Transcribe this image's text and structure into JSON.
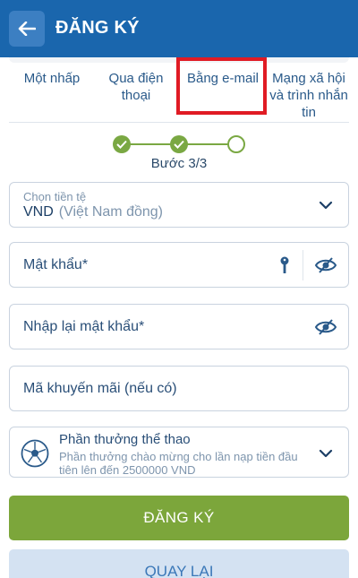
{
  "header": {
    "title": "ĐĂNG KÝ"
  },
  "tabs": [
    {
      "label": "Một nhấp"
    },
    {
      "label": "Qua điện thoại"
    },
    {
      "label": "Bằng e-mail"
    },
    {
      "label": "Mạng xã hội và trình nhắn tin"
    }
  ],
  "stepper": {
    "label": "Bước 3/3",
    "total_steps": 3,
    "completed_steps": 2
  },
  "currency": {
    "label": "Chọn tiền tệ",
    "value": "VND",
    "sub": "(Việt Nam đồng)"
  },
  "password": {
    "placeholder": "Mật khẩu*"
  },
  "confirm_password": {
    "placeholder": "Nhập lại mật khẩu*"
  },
  "promo": {
    "placeholder": "Mã khuyến mãi (nếu có)"
  },
  "bonus": {
    "title": "Phần thưởng thể thao",
    "description": "Phần thưởng chào mừng cho lần nạp tiền đầu tiên lên đến 2500000 VND"
  },
  "buttons": {
    "register": "ĐĂNG KÝ",
    "back": "QUAY LẠI"
  },
  "colors": {
    "header": "#1a66ad",
    "accent_green": "#7ca63b",
    "highlight_red": "#e01b24"
  }
}
